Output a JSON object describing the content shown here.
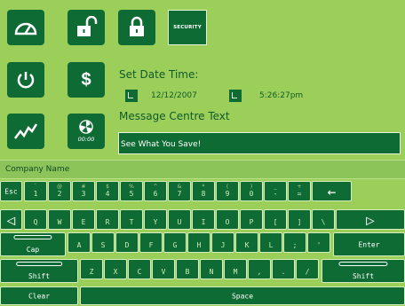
{
  "icons": {
    "speed": "speedometer-icon",
    "unlock": "unlock-icon",
    "lock": "lock-icon",
    "power": "power-icon",
    "dollar": "$",
    "trend": "trend-icon",
    "timer_time": "00:00"
  },
  "security_label": "SECURITY",
  "settings": {
    "date_time_label": "Set Date Time:",
    "date": "12/12/2007",
    "time": "5:26:27pm",
    "message_label": "Message Centre Text",
    "message_value": "See What You Save!"
  },
  "company_label": "Company Name",
  "keyboard": {
    "esc": "Esc",
    "number_row": [
      {
        "top": "`",
        "main": "1"
      },
      {
        "top": "@",
        "main": "2"
      },
      {
        "top": "#",
        "main": "3"
      },
      {
        "top": "$",
        "main": "4"
      },
      {
        "top": "%",
        "main": "5"
      },
      {
        "top": "^",
        "main": "6"
      },
      {
        "top": "&",
        "main": "7"
      },
      {
        "top": "*",
        "main": "8"
      },
      {
        "top": "(",
        "main": "9"
      },
      {
        "top": ")",
        "main": "0"
      },
      {
        "top": "_",
        "main": "-"
      },
      {
        "top": "+",
        "main": "="
      }
    ],
    "backspace": "←",
    "left_arrow": "◁",
    "right_arrow": "▷",
    "row_q": [
      "Q",
      "W",
      "E",
      "R",
      "T",
      "Y",
      "U",
      "I",
      "O",
      "P",
      "[",
      "]",
      "\\"
    ],
    "caps": "Cap",
    "row_a": [
      "A",
      "S",
      "D",
      "F",
      "G",
      "H",
      "J",
      "K",
      "L",
      ";",
      "'"
    ],
    "enter": "Enter",
    "shift": "Shift",
    "row_z": [
      "Z",
      "X",
      "C",
      "V",
      "B",
      "N",
      "M",
      ",",
      ".",
      "/"
    ],
    "clear": "Clear",
    "space": "Space"
  },
  "colors": {
    "background": "#9ccf5a",
    "button": "#0f6b34",
    "border": "#d5eec0"
  }
}
